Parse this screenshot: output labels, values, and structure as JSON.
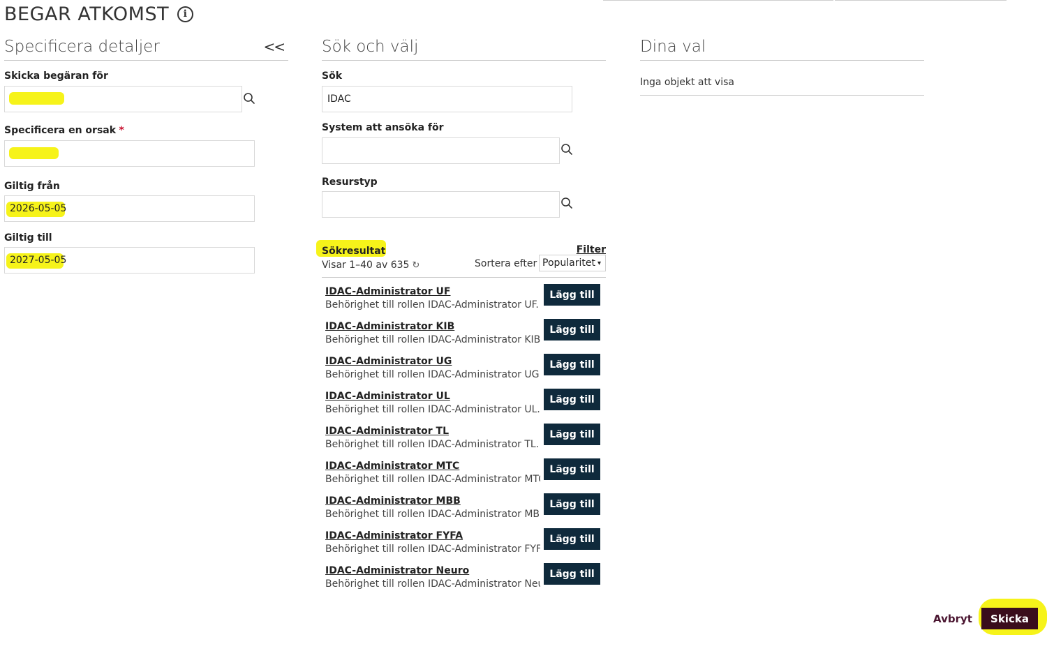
{
  "page": {
    "title": "BEGAR ATKOMST"
  },
  "details": {
    "title": "Specificera detaljer",
    "collapse_label": "<<",
    "request_for_label": "Skicka begäran för",
    "reason_label": "Specificera en orsak",
    "required_mark": "*",
    "valid_from_label": "Giltig från",
    "valid_from_value": "2026-05-05",
    "valid_to_label": "Giltig till",
    "valid_to_value": "2027-05-05"
  },
  "search": {
    "title": "Sök och välj",
    "search_label": "Sök",
    "search_value": "IDAC",
    "system_label": "System att ansöka för",
    "resource_label": "Resurstyp",
    "results_title": "Sökresultat",
    "filter_label": "Filter",
    "count_text": "Visar 1–40 av 635",
    "sort_label": "Sortera efter",
    "sort_value": "Popularitet",
    "add_label": "Lägg till",
    "results": [
      {
        "name": "IDAC-Administrator UF",
        "desc": "Behörighet till rollen IDAC-Administrator UF. D"
      },
      {
        "name": "IDAC-Administrator KIB",
        "desc": "Behörighet till rollen IDAC-Administrator KIB. ["
      },
      {
        "name": "IDAC-Administrator UG",
        "desc": "Behörighet till rollen IDAC-Administrator UG. ["
      },
      {
        "name": "IDAC-Administrator UL",
        "desc": "Behörighet till rollen IDAC-Administrator UL. D"
      },
      {
        "name": "IDAC-Administrator TL",
        "desc": "Behörighet till rollen IDAC-Administrator TL. D"
      },
      {
        "name": "IDAC-Administrator MTC",
        "desc": "Behörighet till rollen IDAC-Administrator MTC."
      },
      {
        "name": "IDAC-Administrator MBB",
        "desc": "Behörighet till rollen IDAC-Administrator MBB."
      },
      {
        "name": "IDAC-Administrator FYFA",
        "desc": "Behörighet till rollen IDAC-Administrator FYFA."
      },
      {
        "name": "IDAC-Administrator Neuro",
        "desc": "Behörighet till rollen IDAC-Administrator Neur"
      }
    ]
  },
  "selection": {
    "title": "Dina val",
    "empty_text": "Inga objekt att visa"
  },
  "footer": {
    "cancel_label": "Avbryt",
    "submit_label": "Skicka"
  },
  "icons": {
    "info": "info-circle-icon",
    "search": "magnifier-icon",
    "refresh": "refresh-icon",
    "chevron": "chevron-down-icon"
  },
  "colors": {
    "highlight": "#f6f31a",
    "add_button": "#0f2a3c",
    "submit_button": "#3a0d1c",
    "cancel_link": "#4a1530",
    "required": "#c8102e"
  }
}
